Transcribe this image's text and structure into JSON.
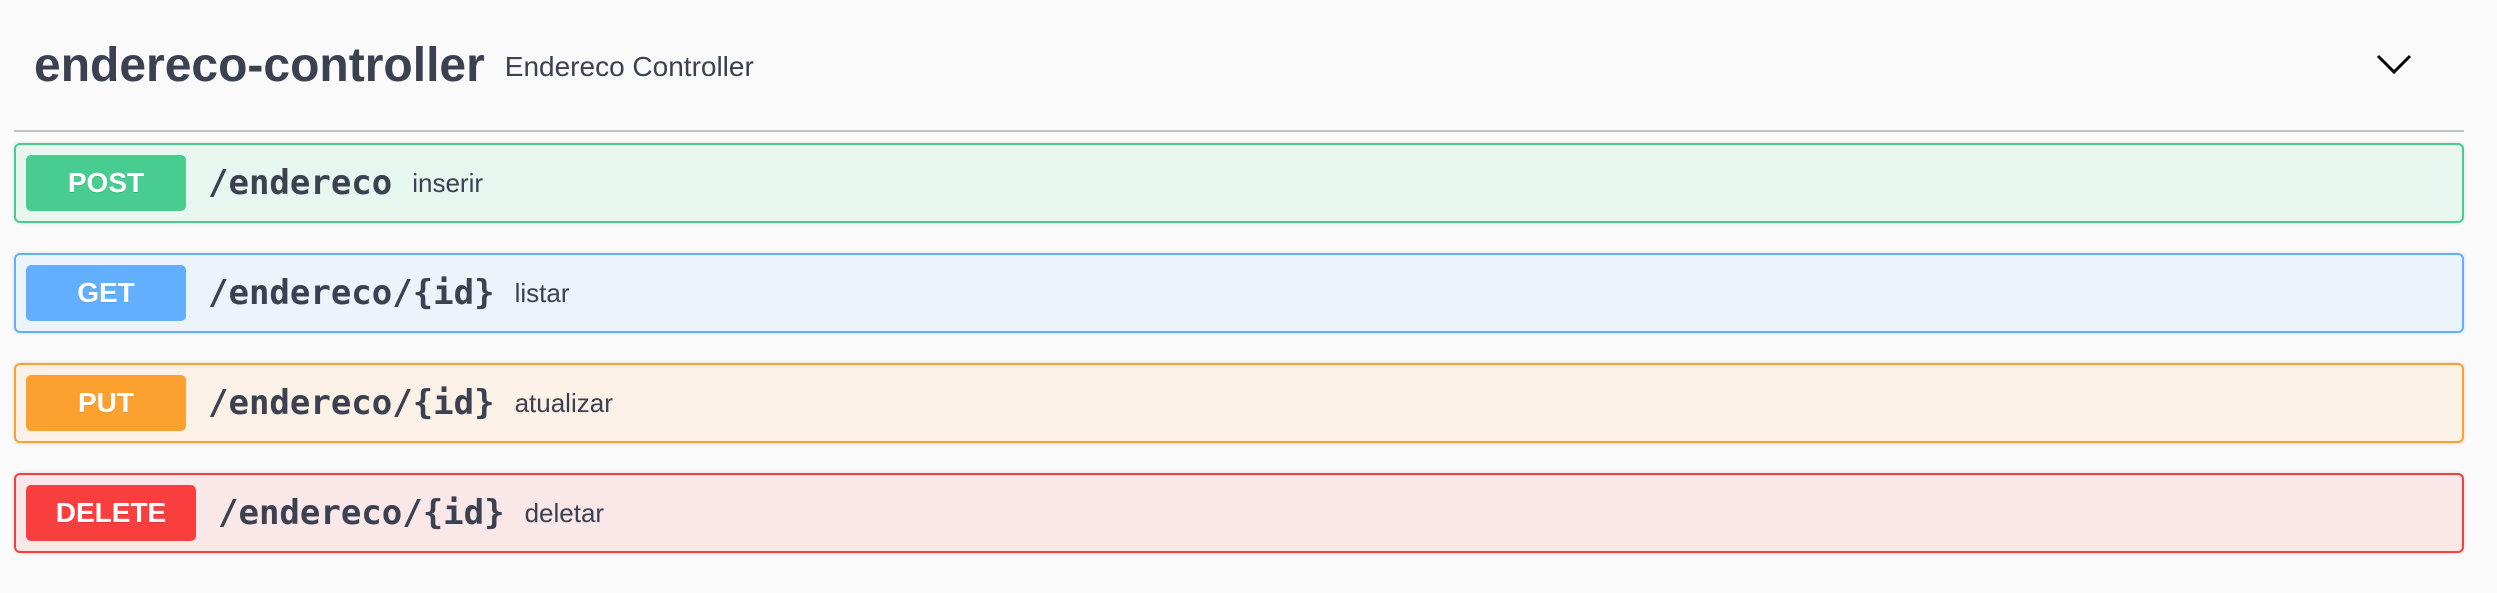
{
  "tag": {
    "name": "endereco-controller",
    "description": "Endereco Controller"
  },
  "operations": [
    {
      "method": "POST",
      "path": "/endereco",
      "summary": "inserir",
      "color": "#49cc90",
      "bg": "#e8f6f0"
    },
    {
      "method": "GET",
      "path": "/endereco/{id}",
      "summary": "listar",
      "color": "#61affe",
      "bg": "#ebf3fb"
    },
    {
      "method": "PUT",
      "path": "/endereco/{id}",
      "summary": "atualizar",
      "color": "#fca130",
      "bg": "#fbf1e6"
    },
    {
      "method": "DELETE",
      "path": "/endereco/{id}",
      "summary": "deletar",
      "color": "#f93e3e",
      "bg": "#fae7e7"
    }
  ],
  "icons": {
    "toggle": "chevron-down-icon"
  }
}
